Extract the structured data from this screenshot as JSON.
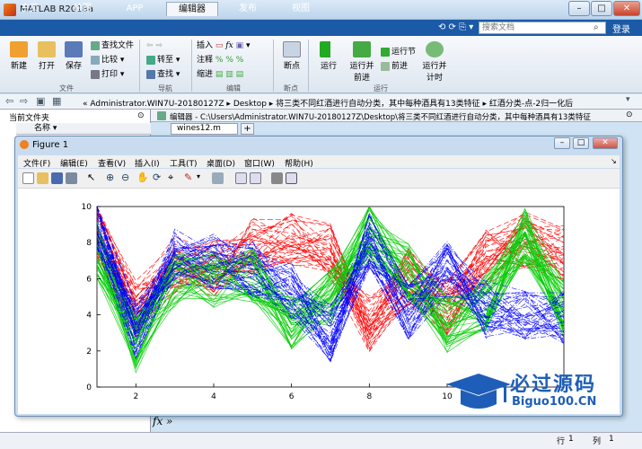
{
  "window": {
    "title": "MATLAB R2018a"
  },
  "tabs": [
    "主页",
    "绘图",
    "APP",
    "编辑器",
    "发布",
    "视图"
  ],
  "active_tab": "编辑器",
  "search": {
    "placeholder": "搜索文档"
  },
  "login": "登录",
  "ribbon": {
    "new": "新建",
    "open": "打开",
    "save": "保存",
    "find_files": "查找文件",
    "compare": "比较",
    "print": "打印",
    "goto": "转至",
    "find": "查找",
    "insert": "插入",
    "comment": "注释",
    "indent": "缩进",
    "breakpoints": "断点",
    "run": "运行",
    "run_advance": "运行并\n前进",
    "run_section": "运行节",
    "advance": "前进",
    "run_time": "运行并\n计时",
    "groups": [
      "文件",
      "导航",
      "编辑",
      "断点",
      "运行"
    ]
  },
  "address": {
    "path": "« Administrator.WIN7U-20180127Z ▸ Desktop ▸ 将三类不同红酒进行自动分类，其中每种酒具有13类特征 ▸ 红酒分类-点-2归一化后"
  },
  "left_panel": {
    "title": "当前文件夹",
    "column": "名称 ▾"
  },
  "editor": {
    "title": "编辑器 - C:\\Users\\Administrator.WIN7U-20180127Z\\Desktop\\将三类不同红酒进行自动分类，其中每种酒具有13类特征",
    "tab": "wines12.m",
    "add": "+"
  },
  "figure": {
    "title": "Figure 1",
    "menus": [
      "文件(F)",
      "编辑(E)",
      "查看(V)",
      "插入(I)",
      "工具(T)",
      "桌面(D)",
      "窗口(W)",
      "帮助(H)"
    ]
  },
  "fx": "fx »",
  "status": {
    "row_label": "行",
    "row": "1",
    "col_label": "列",
    "col": "1"
  },
  "watermark": {
    "top": "必过源码",
    "bottom": "Biguo100.CN"
  },
  "chart_data": {
    "type": "line",
    "title": "",
    "xlabel": "",
    "ylabel": "",
    "xlim": [
      1,
      13
    ],
    "ylim": [
      0,
      10
    ],
    "xticks": [
      2,
      4,
      6,
      8,
      10
    ],
    "yticks": [
      0,
      2,
      4,
      6,
      8,
      10
    ],
    "style": "parallel coordinates, three classes",
    "series": [
      {
        "color": "#ff0000",
        "dash": "6,3",
        "x": [
          1,
          2,
          3,
          4,
          5,
          6,
          7,
          8,
          9,
          10,
          11,
          12,
          13
        ],
        "y": [
          8.6,
          4.3,
          6.8,
          6.6,
          7.8,
          8.3,
          7.6,
          3.5,
          6.1,
          4.4,
          7.1,
          8.2,
          7.5
        ]
      },
      {
        "color": "#00cc00",
        "dash": "",
        "x": [
          1,
          2,
          3,
          4,
          5,
          6,
          7,
          8,
          9,
          10,
          11,
          12,
          13
        ],
        "y": [
          7.6,
          2.3,
          6.0,
          6.0,
          6.3,
          3.5,
          4.9,
          8.6,
          6.4,
          3.5,
          4.7,
          8.5,
          4.3
        ]
      },
      {
        "color": "#0000ff",
        "dash": "6,2,1,2",
        "x": [
          1,
          2,
          3,
          4,
          5,
          6,
          7,
          8,
          9,
          10,
          11,
          12,
          13
        ],
        "y": [
          9.3,
          3.1,
          7.2,
          7.0,
          6.5,
          5.3,
          3.0,
          8.1,
          4.1,
          6.5,
          4.3,
          3.9,
          3.8
        ]
      }
    ]
  }
}
